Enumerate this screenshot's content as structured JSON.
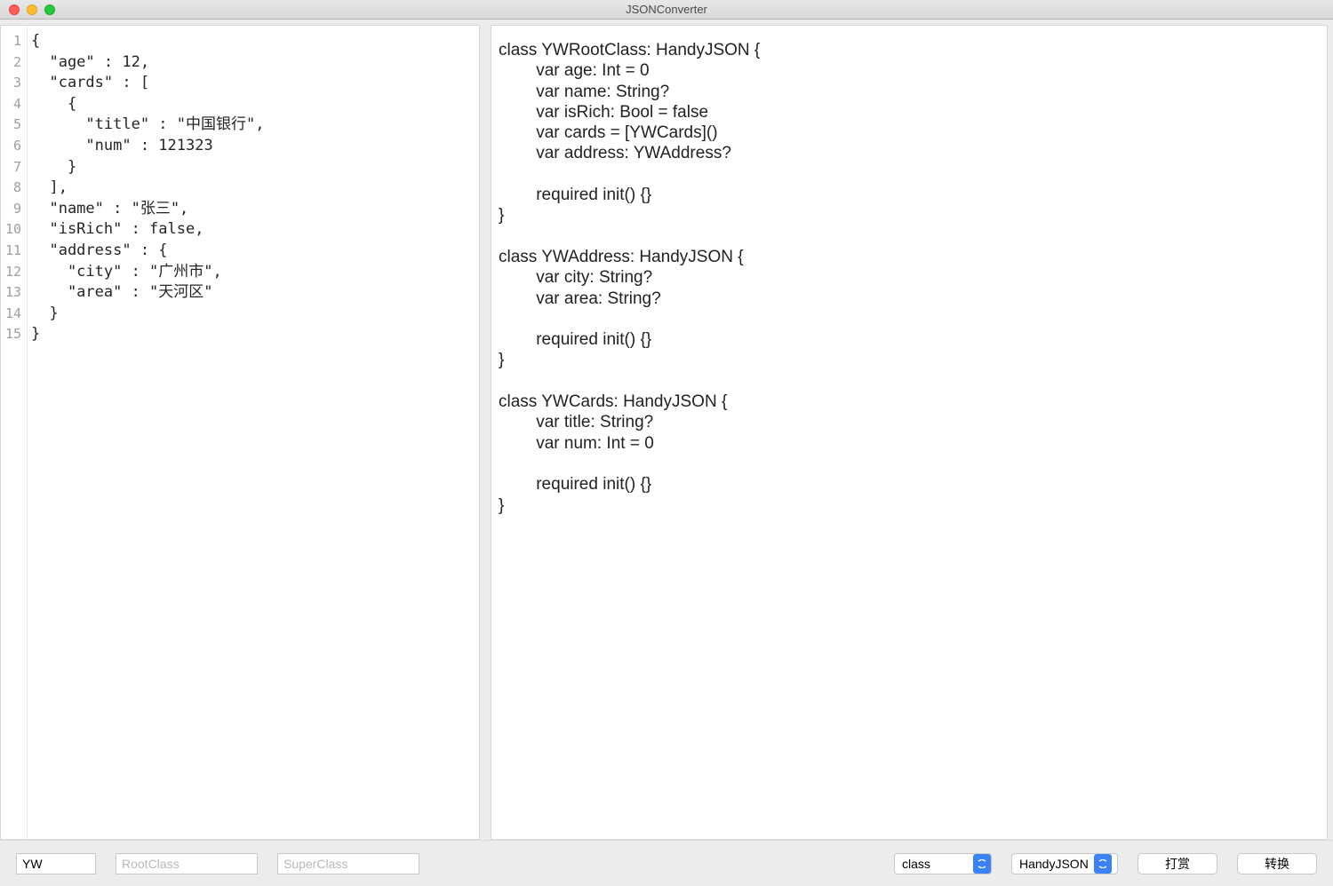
{
  "window": {
    "title": "JSONConverter"
  },
  "editor": {
    "line_numbers": [
      "1",
      "2",
      "3",
      "4",
      "5",
      "6",
      "7",
      "8",
      "9",
      "10",
      "11",
      "12",
      "13",
      "14",
      "15"
    ],
    "json_lines": [
      "{",
      "  \"age\" : 12,",
      "  \"cards\" : [",
      "    {",
      "      \"title\" : \"中国银行\",",
      "      \"num\" : 121323",
      "    }",
      "  ],",
      "  \"name\" : \"张三\",",
      "  \"isRich\" : false,",
      "  \"address\" : {",
      "    \"city\" : \"广州市\",",
      "    \"area\" : \"天河区\"",
      "  }",
      "}"
    ]
  },
  "output": {
    "code": "class YWRootClass: HandyJSON {\n        var age: Int = 0\n        var name: String?\n        var isRich: Bool = false\n        var cards = [YWCards]()\n        var address: YWAddress?\n\n        required init() {}\n}\n\nclass YWAddress: HandyJSON {\n        var city: String?\n        var area: String?\n\n        required init() {}\n}\n\nclass YWCards: HandyJSON {\n        var title: String?\n        var num: Int = 0\n\n        required init() {}\n}"
  },
  "toolbar": {
    "prefix_value": "YW",
    "root_class_placeholder": "RootClass",
    "super_class_placeholder": "SuperClass",
    "type_select_value": "class",
    "lib_select_value": "HandyJSON",
    "donate_label": "打赏",
    "convert_label": "转换"
  }
}
